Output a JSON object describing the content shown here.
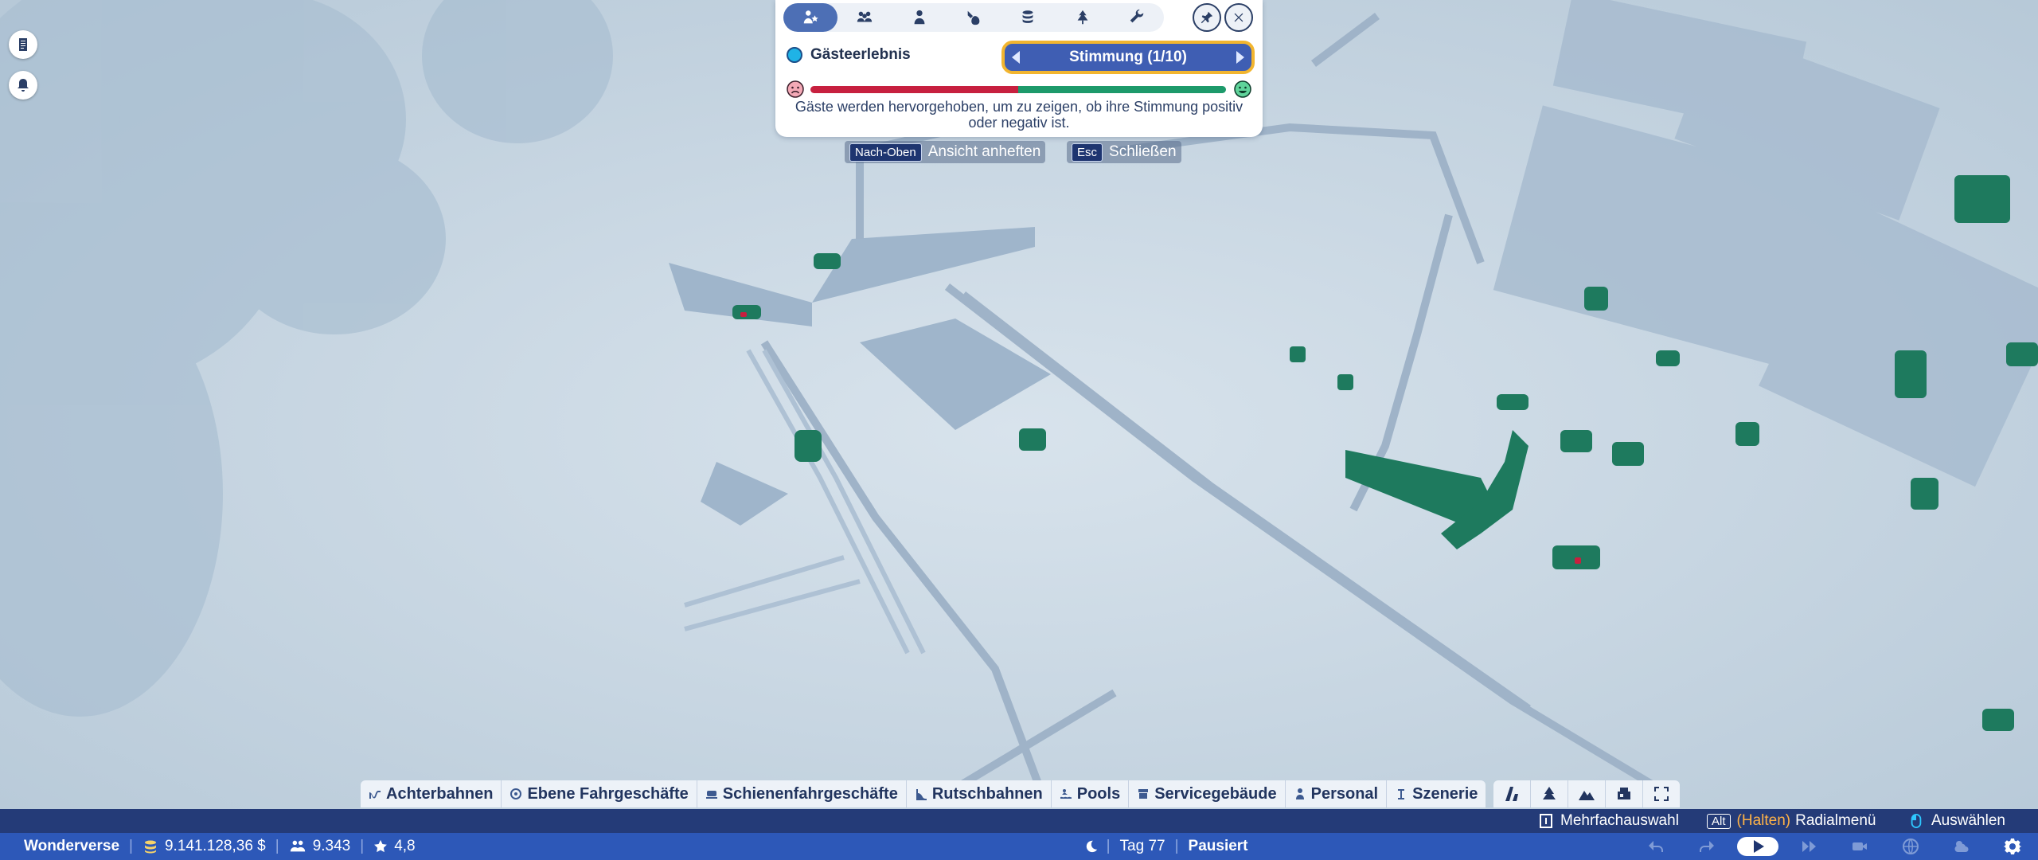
{
  "overlay": {
    "tabs": [
      {
        "name": "guest-experience-tab-icon",
        "active": true
      },
      {
        "name": "guests-tab-icon",
        "active": false
      },
      {
        "name": "single-guest-tab-icon",
        "active": false
      },
      {
        "name": "thoughts-tab-icon",
        "active": false
      },
      {
        "name": "finance-tab-icon",
        "active": false
      },
      {
        "name": "scenery-tab-icon",
        "active": false
      },
      {
        "name": "maintenance-tab-icon",
        "active": false
      }
    ],
    "mode_label": "Gästeerlebnis",
    "selector_value": "Stimmung (1/10)",
    "mood_positive_fraction": 0.5,
    "description": "Gäste werden hervorgehoben, um zu zeigen, ob ihre Stimmung positiv oder negativ ist."
  },
  "hints": {
    "pin_key": "Nach-Oben",
    "pin_label": "Ansicht anheften",
    "close_key": "Esc",
    "close_label": "Schließen"
  },
  "categories": [
    {
      "label": "Achterbahnen",
      "icon": "coaster-icon"
    },
    {
      "label": "Ebene Fahrgeschäfte",
      "icon": "flat-ride-icon"
    },
    {
      "label": "Schienenfahrgeschäfte",
      "icon": "track-ride-icon"
    },
    {
      "label": "Rutschbahnen",
      "icon": "slide-icon"
    },
    {
      "label": "Pools",
      "icon": "pool-icon"
    },
    {
      "label": "Servicegebäude",
      "icon": "shop-icon"
    },
    {
      "label": "Personal",
      "icon": "staff-icon"
    },
    {
      "label": "Szenerie",
      "icon": "scenery-icon"
    }
  ],
  "control_hints": {
    "multi_label": "Mehrfachauswahl",
    "alt_key": "Alt",
    "hold_label": "(Halten)",
    "radial_label": "Radialmenü",
    "select_label": "Auswählen"
  },
  "status": {
    "park_name": "Wonderverse",
    "money": "9.141.128,36 $",
    "guests": "9.343",
    "rating": "4,8",
    "day": "Tag 77",
    "state": "Pausiert"
  },
  "colors": {
    "accent": "#4d6fb5",
    "status_bar": "#2d58b8",
    "mood_negative": "#c7203f",
    "mood_positive": "#1d9a6b",
    "guest_marker": "#1e7a5e"
  }
}
